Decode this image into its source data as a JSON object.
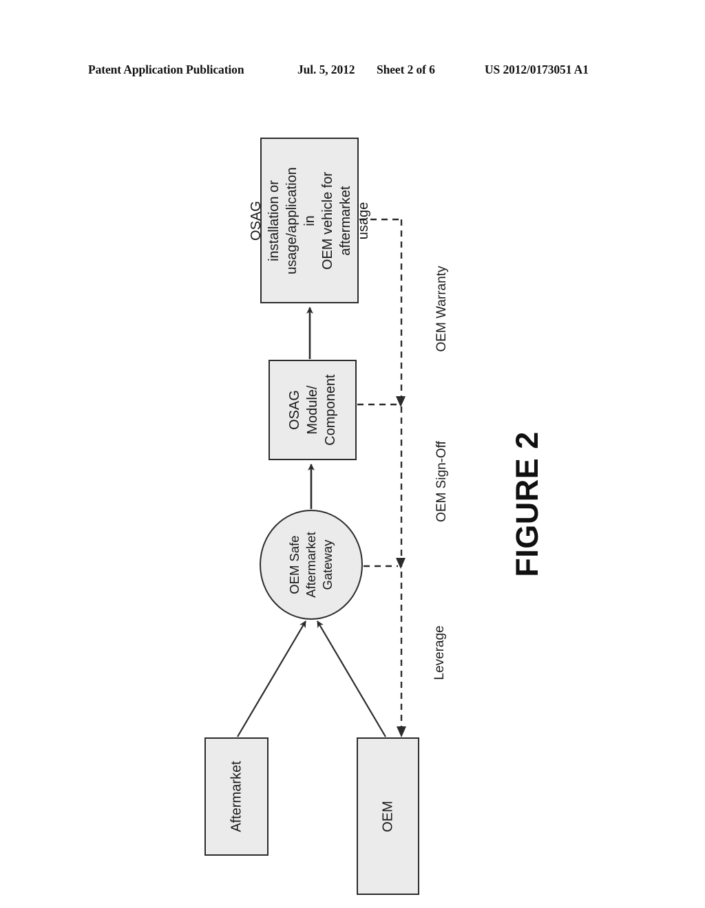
{
  "header": {
    "publication": "Patent Application Publication",
    "date": "Jul. 5, 2012",
    "sheet": "Sheet 2 of 6",
    "patent_number": "US 2012/0173051 A1"
  },
  "figure": {
    "caption": "FIGURE 2",
    "nodes": [
      {
        "id": "osag-usage",
        "shape": "rectangle",
        "label": "OSAG installation or\nusage/application in\nOEM vehicle for\naftermarket usage"
      },
      {
        "id": "osag-module",
        "shape": "rectangle",
        "label": "OSAG\nModule/\nComponent"
      },
      {
        "id": "gateway",
        "shape": "ellipse",
        "label": "OEM Safe\nAftermarket\nGateway"
      },
      {
        "id": "aftermarket",
        "shape": "rectangle",
        "label": "Aftermarket"
      },
      {
        "id": "oem",
        "shape": "rectangle",
        "label": "OEM"
      }
    ],
    "relationship_labels": [
      {
        "id": "oem-warranty",
        "text": "OEM Warranty"
      },
      {
        "id": "oem-sign-off",
        "text": "OEM Sign-Off"
      },
      {
        "id": "leverage",
        "text": "Leverage"
      }
    ],
    "edges": [
      {
        "from": "osag-module",
        "to": "osag-usage",
        "style": "solid"
      },
      {
        "from": "gateway",
        "to": "osag-module",
        "style": "solid"
      },
      {
        "from": "aftermarket",
        "to": "gateway",
        "style": "solid"
      },
      {
        "from": "oem",
        "to": "gateway",
        "style": "solid"
      },
      {
        "from": "osag-usage",
        "to": "osag-module",
        "style": "dashed",
        "label": "OEM Warranty"
      },
      {
        "from": "osag-module",
        "to": "gateway",
        "style": "dashed",
        "label": "OEM Sign-Off"
      },
      {
        "from": "gateway",
        "to": "oem",
        "style": "dashed",
        "label": "Leverage"
      }
    ]
  },
  "colors": {
    "node_fill": "#ebebeb",
    "node_stroke": "#2b2b2b",
    "text": "#181818",
    "page_background": "#ffffff"
  }
}
